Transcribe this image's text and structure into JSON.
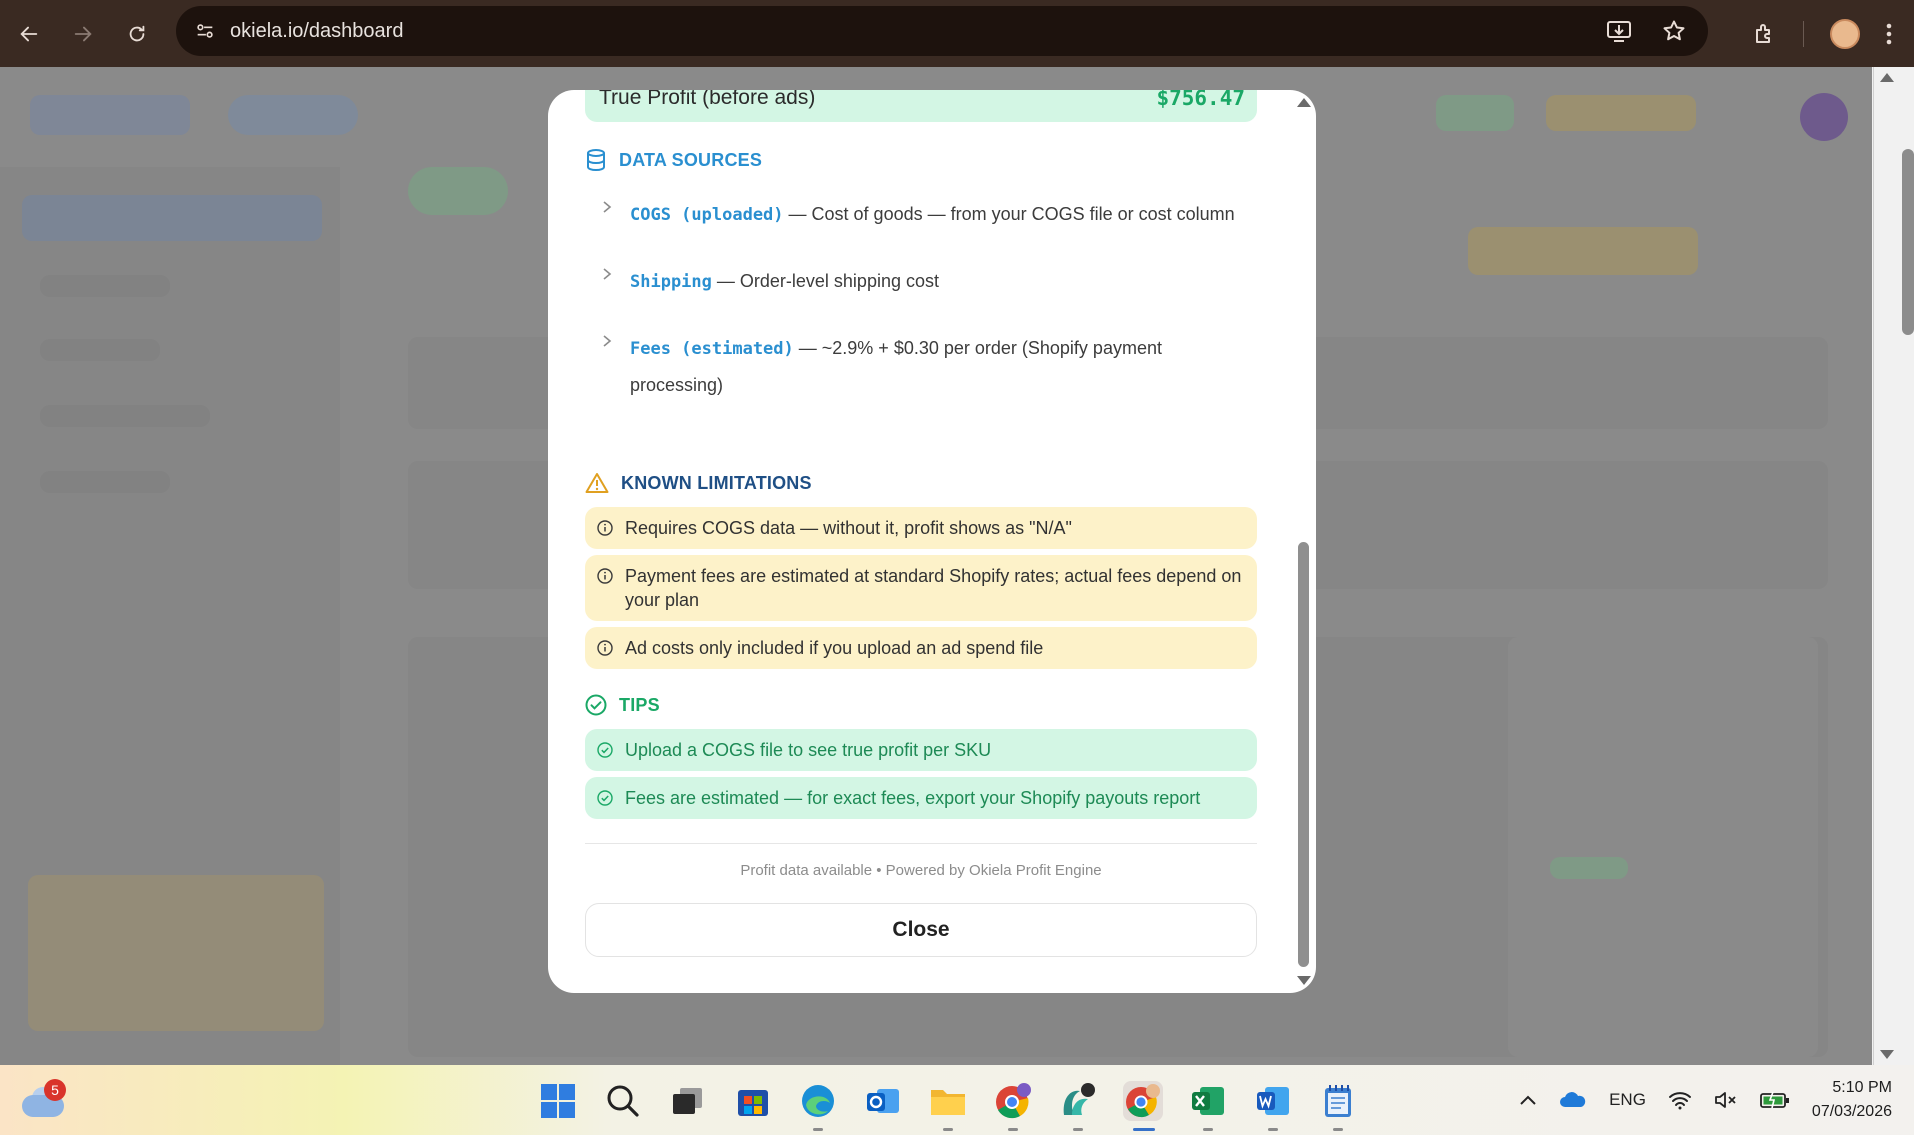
{
  "browser": {
    "url": "okiela.io/dashboard"
  },
  "modal": {
    "true_profit": {
      "label": "True Profit (before ads)",
      "value": "$756.47"
    },
    "data_sources": {
      "heading": "DATA SOURCES",
      "items": [
        {
          "code": "COGS (uploaded)",
          "desc": " — Cost of goods — from your COGS file or cost column"
        },
        {
          "code": "Shipping",
          "desc": " — Order-level shipping cost"
        },
        {
          "code": "Fees (estimated)",
          "desc": " — ~2.9% + $0.30 per order (Shopify payment processing)"
        }
      ]
    },
    "known_limitations": {
      "heading": "KNOWN LIMITATIONS",
      "items": [
        "Requires COGS data — without it, profit shows as \"N/A\"",
        "Payment fees are estimated at standard Shopify rates; actual fees depend on your plan",
        "Ad costs only included if you upload an ad spend file"
      ]
    },
    "tips": {
      "heading": "TIPS",
      "items": [
        "Upload a COGS file to see true profit per SKU",
        "Fees are estimated — for exact fees, export your Shopify payouts report"
      ]
    },
    "footer": "Profit data available • Powered by Okiela Profit Engine",
    "close_label": "Close"
  },
  "taskbar": {
    "weather_badge": "5",
    "language": "ENG",
    "time": "5:10 PM",
    "date": "07/03/2026"
  },
  "colors": {
    "accent_blue": "#2a8fd0",
    "success_green": "#1aa866",
    "warning_bg": "#fdf2c9",
    "tip_bg": "#d3f6e4",
    "heading_navy": "#1f4f85"
  }
}
